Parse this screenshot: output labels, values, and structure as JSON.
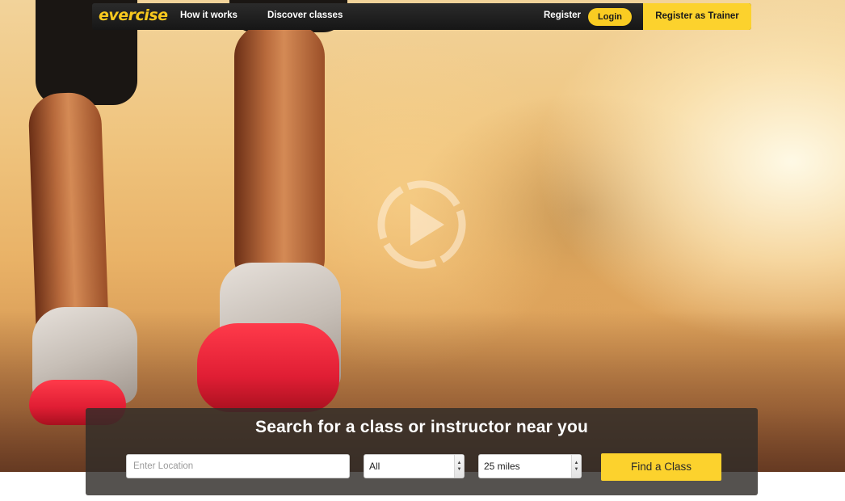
{
  "brand": {
    "logo_text": "evercise",
    "accent_color": "#fcd22d"
  },
  "nav": {
    "how_it_works": "How it works",
    "discover_classes": "Discover classes",
    "register": "Register",
    "login": "Login",
    "register_trainer": "Register as Trainer"
  },
  "hero": {
    "video_play_icon": "play-circle-icon"
  },
  "search": {
    "title": "Search for a class or instructor near you",
    "location_placeholder": "Enter Location",
    "category_value": "All",
    "distance_value": "25 miles",
    "submit_label": "Find a Class"
  }
}
